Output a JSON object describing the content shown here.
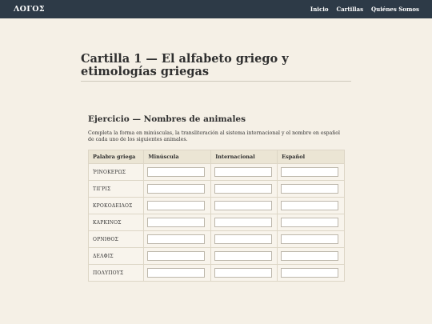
{
  "navbar": {
    "brand": "ΛΟΓΟΣ",
    "links": [
      "Inicio",
      "Cartillas",
      "Quiénes Somos"
    ]
  },
  "page": {
    "title": "Cartilla 1 — El alfabeto griego y etimologías griegas"
  },
  "exercise": {
    "title": "Ejercicio — Nombres de animales",
    "instructions": "Completa la forma en minúsculas, la transliteración al sistema internacional y el nombre en español de cada uno de los siguientes animales.",
    "headers": [
      "Palabra griega",
      "Minúscula",
      "Internacional",
      "Español"
    ],
    "rows": [
      {
        "greek": "ῬΙΝΟΚΕΡΩΣ",
        "minuscula": "",
        "internacional": "",
        "espanol": ""
      },
      {
        "greek": "ΤΙΓΡΙΣ",
        "minuscula": "",
        "internacional": "",
        "espanol": ""
      },
      {
        "greek": "ΚΡΟΚΟΔΕΙΛΟΣ",
        "minuscula": "",
        "internacional": "",
        "espanol": ""
      },
      {
        "greek": "ΚΑΡΚΙΝΟΣ",
        "minuscula": "",
        "internacional": "",
        "espanol": ""
      },
      {
        "greek": "ΟΡΝΙΘΟΣ",
        "minuscula": "",
        "internacional": "",
        "espanol": ""
      },
      {
        "greek": "ΔΕΛΦΙΣ",
        "minuscula": "",
        "internacional": "",
        "espanol": ""
      },
      {
        "greek": "ΠΟΛΥΠΟΥΣ",
        "minuscula": "",
        "internacional": "",
        "espanol": ""
      }
    ]
  }
}
